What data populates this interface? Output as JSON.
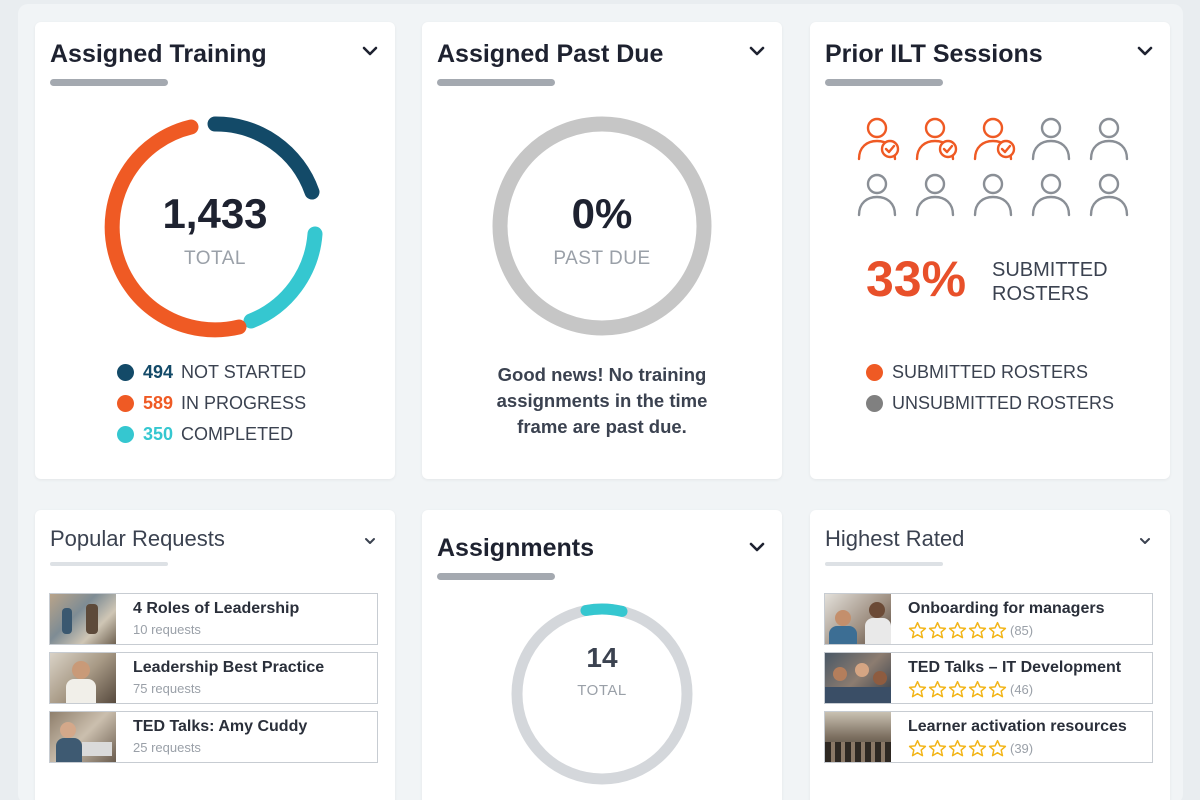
{
  "colors": {
    "navy": "#134a68",
    "orange": "#ef5a24",
    "teal": "#35c7d0",
    "gray_ring": "#c6c6c6",
    "gray_person": "#8a8f96",
    "star": "#f2b519"
  },
  "assigned_training": {
    "title": "Assigned Training",
    "total": "1,433",
    "total_label": "TOTAL",
    "legend": [
      {
        "count": "494",
        "label": "NOT STARTED",
        "color": "#134a68"
      },
      {
        "count": "589",
        "label": "IN PROGRESS",
        "color": "#ef5a24"
      },
      {
        "count": "350",
        "label": "COMPLETED",
        "color": "#35c7d0"
      }
    ],
    "icon": "chevron-down-icon"
  },
  "assigned_past_due": {
    "title": "Assigned Past Due",
    "value": "0%",
    "value_label": "PAST DUE",
    "message": [
      "Good news! No training",
      "assignments in the time",
      "frame are past due."
    ]
  },
  "prior_ilt": {
    "title": "Prior ILT Sessions",
    "submitted_count": 3,
    "total_count": 10,
    "percent": "33%",
    "percent_label": [
      "SUBMITTED",
      "ROSTERS"
    ],
    "legend": [
      {
        "label": "SUBMITTED ROSTERS",
        "color": "#ef5a24"
      },
      {
        "label": "UNSUBMITTED ROSTERS",
        "color": "#808080"
      }
    ],
    "icon": "person-icon"
  },
  "popular_requests": {
    "title": "Popular Requests",
    "items": [
      {
        "title": "4 Roles of Leadership",
        "sub": "10 requests"
      },
      {
        "title": "Leadership Best Practice",
        "sub": "75 requests"
      },
      {
        "title": "TED Talks: Amy Cuddy",
        "sub": "25 requests"
      }
    ]
  },
  "assignments": {
    "title": "Assignments",
    "total": "14",
    "total_label": "TOTAL"
  },
  "highest_rated": {
    "title": "Highest Rated",
    "items": [
      {
        "title": "Onboarding for managers",
        "count": "(85)",
        "stars": 5
      },
      {
        "title": "TED Talks – IT Development",
        "count": "(46)",
        "stars": 5
      },
      {
        "title": "Learner activation resources",
        "count": "(39)",
        "stars": 5
      }
    ]
  }
}
